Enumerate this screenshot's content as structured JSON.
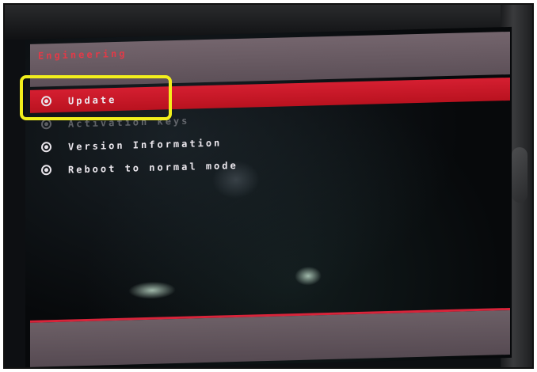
{
  "screen": {
    "title": "Engineering",
    "menu": {
      "items": [
        {
          "label": "Update",
          "selected": true
        },
        {
          "label": "Activation keys",
          "selected": false
        },
        {
          "label": "Version Information",
          "selected": false
        },
        {
          "label": "Reboot to normal mode",
          "selected": false
        }
      ]
    }
  },
  "colors": {
    "accent_red": "#d51f31",
    "header_mauve": "#6a5c64",
    "highlight_yellow": "#f2ef1c",
    "text_white": "#ece8ee"
  },
  "icons": {
    "menu_item_icon": "radio-bullet-icon"
  },
  "annotation": {
    "highlighted_item": "Update"
  }
}
